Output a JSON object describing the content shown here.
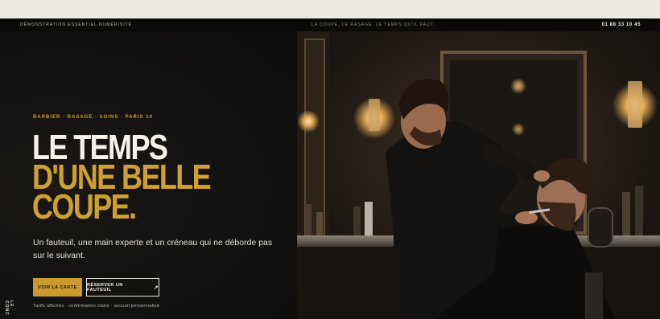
{
  "announcement": {
    "left": "Démonstration Essentiel Numérisité",
    "center": "La coupe, le rasage, le temps qu'il faut.",
    "phone": "01 88 33 10 45"
  },
  "hero": {
    "eyebrow": "Barbier · Rasage · Soins · Paris 10",
    "headline_line1": "Le temps",
    "headline_line2": "d'une belle",
    "headline_line3": "coupe.",
    "lede": "Un fauteuil, une main experte et un créneau qui ne déborde pas sur le suivant.",
    "cta_primary": "Voir la carte",
    "cta_secondary": "Réserver un fauteuil",
    "cta_secondary_icon": "↗",
    "fineprint": "Tarifs affichés · confirmation claire · accueil personnalisé",
    "vertical_text": "Le conc"
  },
  "photo": {
    "icon": "barbershop-photo"
  },
  "colors": {
    "accent": "#c99a2c",
    "background": "#0f0e0c",
    "text": "#f1ede4"
  }
}
